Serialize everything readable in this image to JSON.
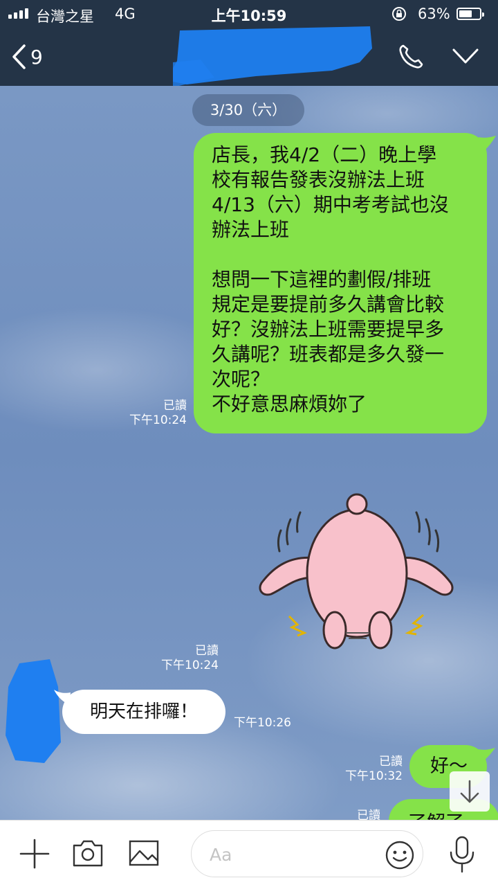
{
  "status_bar": {
    "carrier": "台灣之星",
    "network": "4G",
    "time": "上午10:59",
    "battery_percent": "63%",
    "battery_level": 0.63,
    "signal_bars": 4
  },
  "header": {
    "back_count": "9",
    "contact_name_redacted": true
  },
  "chat": {
    "date_label": "3/30（六）",
    "messages": [
      {
        "id": "long-request",
        "side": "right",
        "text": "店長，我4/2（二）晚上學\n校有報告發表沒辦法上班\n4/13（六）期中考考試也沒\n辦法上班\n\n想問一下這裡的劃假/排班\n規定是要提前多久講會比較\n好？沒辦法上班需要提早多\n久講呢？班表都是多久發一\n次呢？\n不好意思麻煩妳了",
        "read": "已讀",
        "time": "下午10:24"
      },
      {
        "id": "sticker",
        "side": "right",
        "type": "sticker",
        "sticker_name": "pink-bowing-character-sticker",
        "read": "已讀",
        "time": "下午10:24"
      },
      {
        "id": "reply",
        "side": "left",
        "text": "明天在排囉！",
        "time": "下午10:26"
      },
      {
        "id": "ok",
        "side": "right",
        "text": "好～",
        "read": "已讀",
        "time": "下午10:32"
      },
      {
        "id": "partial",
        "side": "right",
        "text": "了解了",
        "read": "已讀"
      }
    ]
  },
  "input_bar": {
    "placeholder": "Aa",
    "icons": [
      "plus-icon",
      "camera-icon",
      "image-icon",
      "emoji-icon",
      "mic-icon"
    ]
  },
  "colors": {
    "header_bg": "#243447",
    "my_bubble": "#85e249",
    "their_bubble": "#ffffff",
    "chat_bg": "#6f8fbd",
    "redaction": "#1f7ff0"
  }
}
